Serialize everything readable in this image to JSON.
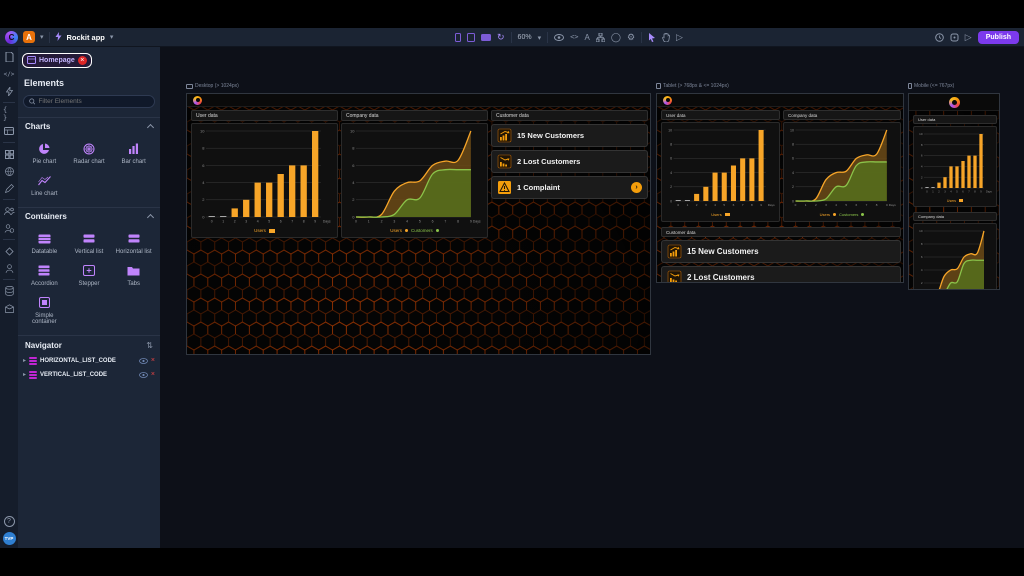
{
  "toolbar": {
    "workspace_badge": "A",
    "app_name": "Rockit app",
    "zoom_level": "60%",
    "publish_label": "Publish"
  },
  "panel": {
    "tab_label": "Homepage",
    "title": "Elements",
    "filter_placeholder": "Filter Elements",
    "charts_section": {
      "label": "Charts",
      "items": [
        {
          "label": "Pie chart"
        },
        {
          "label": "Radar chart"
        },
        {
          "label": "Bar chart"
        },
        {
          "label": "Line chart"
        }
      ]
    },
    "containers_section": {
      "label": "Containers",
      "items": [
        {
          "label": "Datatable"
        },
        {
          "label": "Vertical list"
        },
        {
          "label": "Horizontal list"
        },
        {
          "label": "Accordion"
        },
        {
          "label": "Stepper"
        },
        {
          "label": "Tabs"
        },
        {
          "label": "Simple container"
        }
      ]
    },
    "navigator": {
      "label": "Navigator",
      "rows": [
        {
          "label": "HORIZONTAL_LIST_CODE"
        },
        {
          "label": "VERTICAL_LIST_CODE"
        }
      ]
    }
  },
  "user": {
    "avatar_initials": "TVP"
  },
  "canvas": {
    "frames": [
      {
        "label": "Desktop (> 1024px)"
      },
      {
        "label": "Tablet (> 768px & <= 1024px)"
      },
      {
        "label": "Mobile (<= 767px)"
      }
    ],
    "cards": {
      "user": "User data",
      "company": "Company data",
      "customer": "Customer data"
    },
    "customer_items": [
      {
        "label": "15 New Customers",
        "icon": "chart-up-icon"
      },
      {
        "label": "2 Lost Customers",
        "icon": "chart-down-icon"
      },
      {
        "label": "1 Complaint",
        "icon": "warning-icon",
        "has_arrow": true
      }
    ],
    "accent_orange": "#f59e0b",
    "hex_pattern_color": "#ff5400"
  },
  "chart_data": [
    {
      "id": "users_bar",
      "type": "bar",
      "title": "User data",
      "categories": [
        "0",
        "1",
        "2",
        "3",
        "4",
        "5",
        "6",
        "7",
        "8",
        "9"
      ],
      "values": [
        0,
        0,
        1,
        2,
        4,
        4,
        5,
        6,
        6,
        10
      ],
      "series_name": "Users",
      "color": "#f7a528",
      "xlabel": "Days",
      "ylabel": "",
      "ylim": [
        0,
        10
      ],
      "yticks": [
        0,
        2,
        4,
        6,
        8,
        10
      ],
      "grid": true,
      "legend_position": "bottom"
    },
    {
      "id": "company_area",
      "type": "area",
      "title": "Company data",
      "x": [
        0,
        1,
        2,
        3,
        4,
        5,
        6,
        7,
        8,
        9
      ],
      "series": [
        {
          "name": "Users",
          "color": "#f7a528",
          "fill": "#6b4a16",
          "values": [
            0,
            0,
            0.3,
            3,
            4,
            4.2,
            6,
            6.5,
            6.6,
            10
          ]
        },
        {
          "name": "Customers",
          "color": "#8bc34a",
          "fill": "#55701c",
          "values": [
            0,
            0,
            0,
            0.3,
            2,
            2.2,
            5,
            5.5,
            5.5,
            5.5
          ]
        }
      ],
      "xlabel": "Days",
      "ylabel": "",
      "ylim": [
        0,
        10
      ],
      "yticks": [
        0,
        2,
        4,
        6,
        8,
        10
      ],
      "grid": true,
      "legend_position": "bottom"
    }
  ]
}
